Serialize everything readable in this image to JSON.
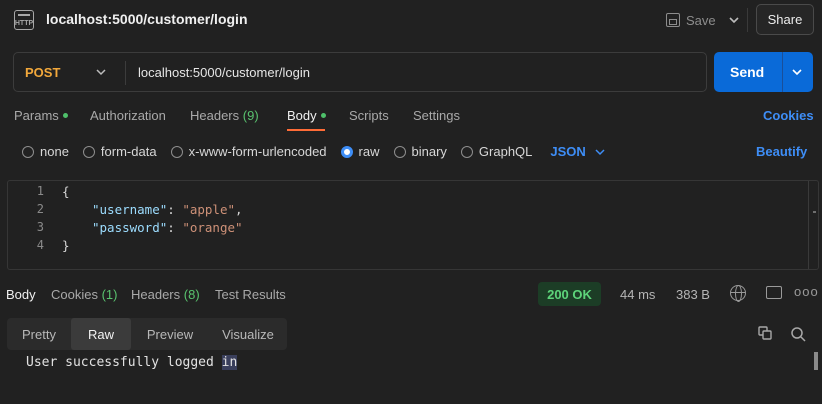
{
  "header": {
    "title": "localhost:5000/customer/login",
    "save_label": "Save",
    "share_label": "Share",
    "icon_label": "HTTP"
  },
  "url_bar": {
    "method": "POST",
    "url": "localhost:5000/customer/login",
    "send_label": "Send"
  },
  "request_tabs": {
    "params": "Params",
    "authorization": "Authorization",
    "headers": "Headers",
    "headers_count": "(9)",
    "body": "Body",
    "scripts": "Scripts",
    "settings": "Settings",
    "cookies": "Cookies"
  },
  "body_types": {
    "none": "none",
    "form_data": "form-data",
    "urlencoded": "x-www-form-urlencoded",
    "raw": "raw",
    "binary": "binary",
    "graphql": "GraphQL",
    "format": "JSON",
    "beautify": "Beautify",
    "selected": "raw"
  },
  "editor": {
    "line_numbers": [
      "1",
      "2",
      "3",
      "4"
    ],
    "open_brace": "{",
    "close_brace": "}",
    "key1": "\"username\"",
    "val1": "\"apple\"",
    "key2": "\"password\"",
    "val2": "\"orange\""
  },
  "response_tabs": {
    "body": "Body",
    "cookies": "Cookies",
    "cookies_count": "(1)",
    "headers": "Headers",
    "headers_count": "(8)",
    "test_results": "Test Results"
  },
  "response_meta": {
    "status": "200 OK",
    "time": "44 ms",
    "size": "383 B",
    "more": "ooo"
  },
  "view_modes": {
    "pretty": "Pretty",
    "raw": "Raw",
    "preview": "Preview",
    "visualize": "Visualize",
    "selected": "Raw"
  },
  "response": {
    "text_main": "User successfully logged ",
    "text_selected": "in"
  },
  "colors": {
    "accent_blue": "#0a6ad8",
    "method_orange": "#f2a83b",
    "status_green": "#5dd47a",
    "tab_underline": "#ff6c37"
  }
}
